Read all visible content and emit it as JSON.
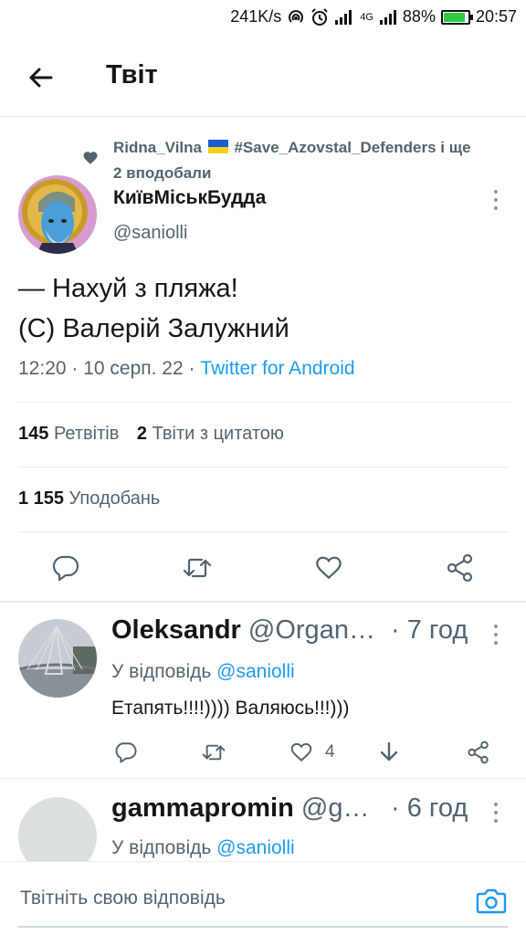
{
  "status_bar": {
    "speed": "241K/s",
    "network": "4G",
    "battery_percent_text": "88%",
    "battery_level": 0.88,
    "time": "20:57"
  },
  "header": {
    "title": "Твіт",
    "back_icon": "arrow-left-icon"
  },
  "tweet": {
    "liked_by_user1": "Ridna_Vilna",
    "liked_by_user2": "#Save_Azovstal_Defenders і ще",
    "liked_by_count": "2 вподобали",
    "author_name": "КиївМіськБудда",
    "author_handle": "@saniolli",
    "text_line1": "— Нахуй з пляжа!",
    "text_line2": "(С) Валерій Залужний",
    "timestamp": "12:20 · 10 серп. 22 · ",
    "source": "Twitter for Android",
    "retweets_count": "145",
    "retweets_label": "Ретвітів",
    "quotes_count": "2",
    "quotes_label": "Твіти з цитатою",
    "likes_count": "1 155",
    "likes_label": "Уподобань"
  },
  "replies": [
    {
      "name": "Oleksandr",
      "handle": "@Organ…",
      "time": "· 7 год",
      "reply_prefix": "У відповідь ",
      "reply_to": "@saniolli",
      "text": "Етапять!!!!)))) Валяюсь!!!)))",
      "like_count": "4"
    },
    {
      "name": "gammapromin",
      "handle": "@g…",
      "time": "· 6 год",
      "reply_prefix": "У відповідь ",
      "reply_to": "@saniolli"
    }
  ],
  "composer": {
    "placeholder": "Твітніть свою відповідь"
  },
  "colors": {
    "accent": "#1d9bf0",
    "secondary_text": "#536471",
    "divider": "#e6ecf0"
  }
}
